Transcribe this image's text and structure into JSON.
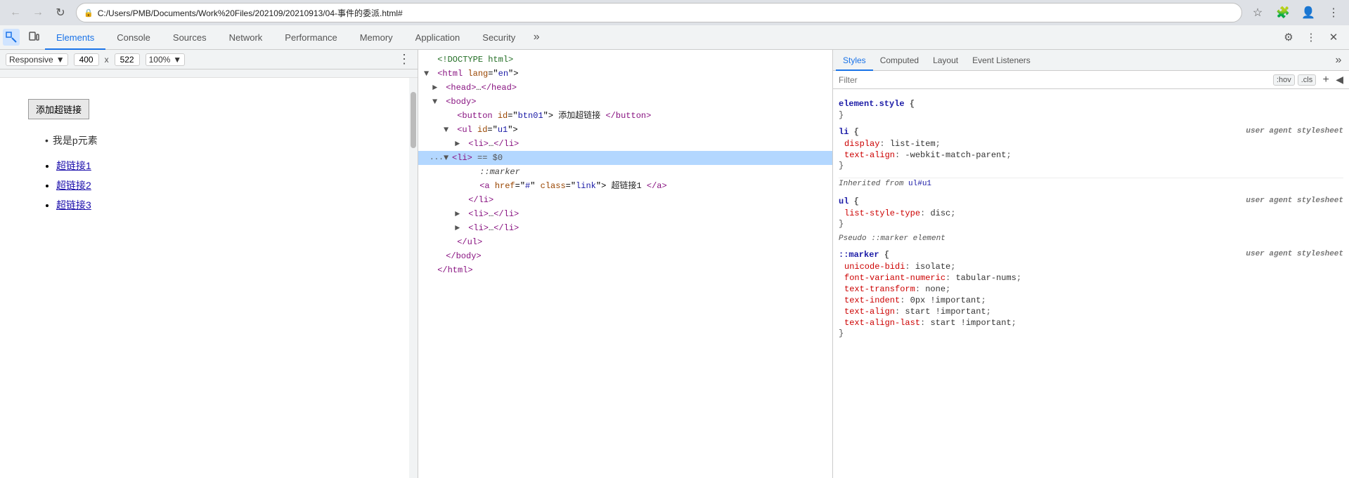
{
  "browser": {
    "back_disabled": true,
    "forward_disabled": true,
    "reload_label": "↻",
    "address": "C:/Users/PMB/Documents/Work%20Files/202109/20210913/04-事件的委派.html#",
    "address_icon": "🔒",
    "star_label": "☆",
    "extension_label": "🧩",
    "profile_label": "👤"
  },
  "devtools": {
    "tabs": [
      {
        "id": "elements",
        "label": "Elements",
        "active": true
      },
      {
        "id": "console",
        "label": "Console",
        "active": false
      },
      {
        "id": "sources",
        "label": "Sources",
        "active": false
      },
      {
        "id": "network",
        "label": "Network",
        "active": false
      },
      {
        "id": "performance",
        "label": "Performance",
        "active": false
      },
      {
        "id": "memory",
        "label": "Memory",
        "active": false
      },
      {
        "id": "application",
        "label": "Application",
        "active": false
      },
      {
        "id": "security",
        "label": "Security",
        "active": false
      }
    ],
    "more_tabs": "»",
    "settings_icon": "⚙",
    "more_options": "⋮",
    "close_icon": "✕"
  },
  "viewport": {
    "responsive_label": "Responsive",
    "width_value": "400",
    "height_value": "522",
    "zoom_label": "100%",
    "more_icon": "⋮"
  },
  "page": {
    "button_label": "添加超链接",
    "p_text": "我是p元素",
    "links": [
      "超链接1",
      "超链接2",
      "超链接3"
    ]
  },
  "elements": {
    "inspect_tool_active": true,
    "device_toggle": "📱",
    "html_lines": [
      {
        "indent": 0,
        "content": "<!DOCTYPE html>",
        "type": "comment"
      },
      {
        "indent": 0,
        "content": "<html lang=\"en\">",
        "type": "tag"
      },
      {
        "indent": 1,
        "content": "<head>…</head>",
        "type": "collapsed"
      },
      {
        "indent": 1,
        "content": "<body>",
        "type": "tag",
        "expandable": true
      },
      {
        "indent": 2,
        "content": "<button id=\"btn01\">添加超链接</button>",
        "type": "tag"
      },
      {
        "indent": 2,
        "content": "<ul id=\"u1\">",
        "type": "tag",
        "expandable": true
      },
      {
        "indent": 3,
        "content": "<li>…</li>",
        "type": "collapsed"
      },
      {
        "indent": 3,
        "content": "<li> == $0",
        "type": "tag",
        "selected": true,
        "expandable": true
      },
      {
        "indent": 4,
        "content": "::marker",
        "type": "pseudo"
      },
      {
        "indent": 4,
        "content": "<a href=\"#\" class=\"link\">超链接1</a>",
        "type": "tag"
      },
      {
        "indent": 3,
        "content": "</li>",
        "type": "tag"
      },
      {
        "indent": 3,
        "content": "<li>…</li>",
        "type": "collapsed"
      },
      {
        "indent": 3,
        "content": "<li>…</li>",
        "type": "collapsed"
      },
      {
        "indent": 2,
        "content": "</ul>",
        "type": "tag"
      },
      {
        "indent": 1,
        "content": "</body>",
        "type": "tag"
      },
      {
        "indent": 0,
        "content": "</html>",
        "type": "tag"
      }
    ],
    "dots_label": "..."
  },
  "styles": {
    "tabs": [
      {
        "id": "styles",
        "label": "Styles",
        "active": true
      },
      {
        "id": "computed",
        "label": "Computed",
        "active": false
      },
      {
        "id": "layout",
        "label": "Layout",
        "active": false
      },
      {
        "id": "event-listeners",
        "label": "Event Listeners",
        "active": false
      }
    ],
    "more_tabs": "»",
    "filter_placeholder": "Filter",
    "hov_label": ":hov",
    "cls_label": ".cls",
    "plus_label": "+",
    "expand_label": "◀",
    "rules": [
      {
        "selector": "element.style",
        "source": "",
        "props": [],
        "brace_open": "{",
        "brace_close": "}"
      },
      {
        "selector": "li",
        "source": "user agent stylesheet",
        "brace_open": "{",
        "brace_close": "}",
        "props": [
          {
            "name": "display",
            "value": "list-item",
            "sep": ":"
          },
          {
            "name": "text-align",
            "value": "-webkit-match-parent",
            "sep": ":"
          }
        ]
      },
      {
        "inherited_label": "Inherited from",
        "inherited_from": "ul#u1"
      },
      {
        "selector": "ul",
        "source": "user agent stylesheet",
        "brace_open": "{",
        "brace_close": "}",
        "props": [
          {
            "name": "list-style-type",
            "value": "disc",
            "sep": ":"
          }
        ]
      },
      {
        "pseudo_label": "Pseudo ::marker element"
      },
      {
        "selector": "::marker",
        "source": "user agent stylesheet",
        "brace_open": "{",
        "brace_close": "}",
        "props": [
          {
            "name": "unicode-bidi",
            "value": "isolate",
            "sep": ":"
          },
          {
            "name": "font-variant-numeric",
            "value": "tabular-nums",
            "sep": ":"
          },
          {
            "name": "text-transform",
            "value": "none",
            "sep": ":"
          },
          {
            "name": "text-indent",
            "value": "0px !important",
            "sep": ":"
          },
          {
            "name": "text-align",
            "value": "start !important",
            "sep": ":"
          },
          {
            "name": "text-align-last",
            "value": "start !important",
            "sep": ":"
          }
        ]
      }
    ]
  }
}
